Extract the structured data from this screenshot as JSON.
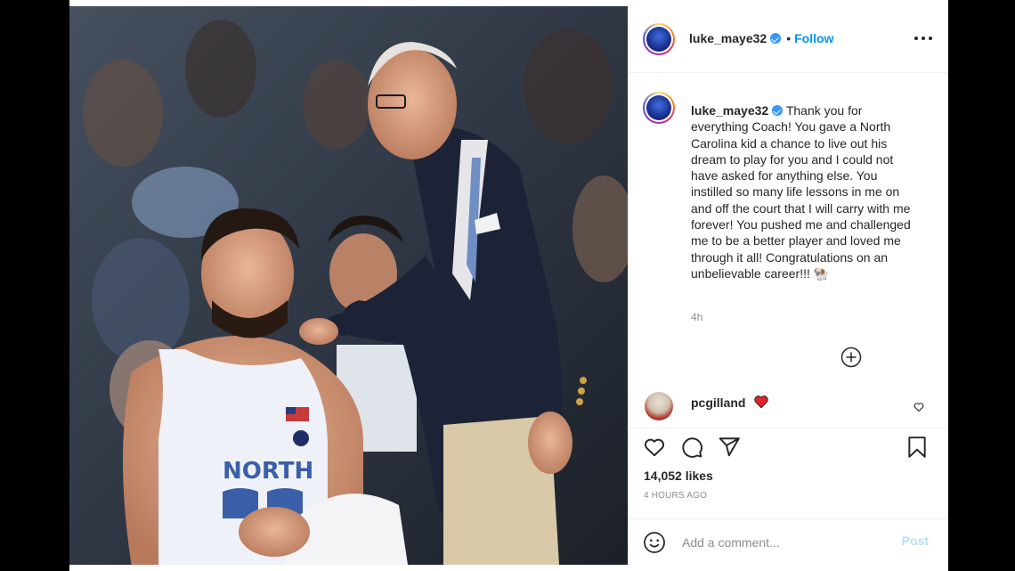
{
  "post": {
    "author": {
      "username": "luke_maye32",
      "verified": true
    },
    "header": {
      "follow_label": "Follow",
      "separator": "•"
    },
    "caption": {
      "username": "luke_maye32",
      "text": "Thank you for everything Coach! You gave a North Carolina kid a chance to live out his dream to play for you and I could not have asked for anything else. You instilled so many life lessons in me on and off the court that I will carry with me forever! You pushed me and challenged me to be a better player and loved me through it all! Congratulations on an unbelievable career!!! 🐏",
      "time": "4h"
    },
    "comment": {
      "username": "pcgilland",
      "emoji": "❤️"
    },
    "likes": "14,052 likes",
    "post_time": "4 HOURS AGO",
    "comment_box": {
      "placeholder": "Add a comment...",
      "post_label": "Post"
    },
    "photo": {
      "jersey_text": "NORTH"
    },
    "colors": {
      "accent": "#0095f6",
      "verified": "#3897f0",
      "muted": "#8e8e8e",
      "heart": "#ed4956",
      "post_disabled": "#b2dffc"
    },
    "icons": [
      "more-options-icon",
      "verified-icon",
      "plus-circle-icon",
      "heart-icon",
      "comment-icon",
      "share-icon",
      "bookmark-icon",
      "emoji-icon"
    ]
  }
}
